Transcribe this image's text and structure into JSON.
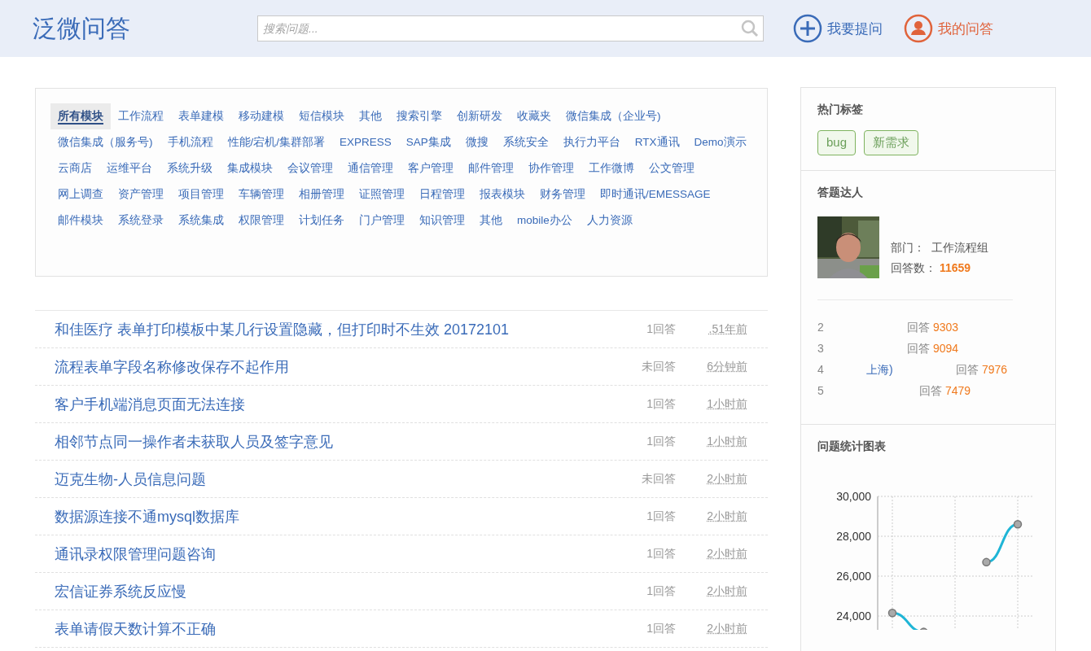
{
  "header": {
    "logo": "泛微问答",
    "search": {
      "placeholder": "搜索问题..."
    },
    "actions": [
      {
        "kind": "ask",
        "label": "我要提问"
      },
      {
        "kind": "mine",
        "label": "我的问答"
      }
    ]
  },
  "modules": [
    {
      "label": "所有模块",
      "selected": true
    },
    {
      "label": "工作流程",
      "selected": false
    },
    {
      "label": "表单建模",
      "selected": false
    },
    {
      "label": "移动建模",
      "selected": false
    },
    {
      "label": "短信模块",
      "selected": false
    },
    {
      "label": "其他",
      "selected": false
    },
    {
      "label": "搜索引擎",
      "selected": false
    },
    {
      "label": "创新研发",
      "selected": false
    },
    {
      "label": "收藏夹",
      "selected": false
    },
    {
      "label": "微信集成（企业号)",
      "selected": false
    },
    {
      "label": "微信集成（服务号)",
      "selected": false
    },
    {
      "label": "手机流程",
      "selected": false
    },
    {
      "label": "性能/宕机/集群部署",
      "selected": false
    },
    {
      "label": "EXPRESS",
      "selected": false
    },
    {
      "label": "SAP集成",
      "selected": false
    },
    {
      "label": "微搜",
      "selected": false
    },
    {
      "label": "系统安全",
      "selected": false
    },
    {
      "label": "执行力平台",
      "selected": false
    },
    {
      "label": "RTX通讯",
      "selected": false
    },
    {
      "label": "Demo演示",
      "selected": false
    },
    {
      "label": "云商店",
      "selected": false
    },
    {
      "label": "运维平台",
      "selected": false
    },
    {
      "label": "系统升级",
      "selected": false
    },
    {
      "label": "集成模块",
      "selected": false
    },
    {
      "label": "会议管理",
      "selected": false
    },
    {
      "label": "通信管理",
      "selected": false
    },
    {
      "label": "客户管理",
      "selected": false
    },
    {
      "label": "邮件管理",
      "selected": false
    },
    {
      "label": "协作管理",
      "selected": false
    },
    {
      "label": "工作微博",
      "selected": false
    },
    {
      "label": "公文管理",
      "selected": false
    },
    {
      "label": "网上调查",
      "selected": false
    },
    {
      "label": "资产管理",
      "selected": false
    },
    {
      "label": "项目管理",
      "selected": false
    },
    {
      "label": "车辆管理",
      "selected": false
    },
    {
      "label": "相册管理",
      "selected": false
    },
    {
      "label": "证照管理",
      "selected": false
    },
    {
      "label": "日程管理",
      "selected": false
    },
    {
      "label": "报表模块",
      "selected": false
    },
    {
      "label": "财务管理",
      "selected": false
    },
    {
      "label": "即时通讯/EMESSAGE",
      "selected": false
    },
    {
      "label": "邮件模块",
      "selected": false
    },
    {
      "label": "系统登录",
      "selected": false
    },
    {
      "label": "系统集成",
      "selected": false
    },
    {
      "label": "权限管理",
      "selected": false
    },
    {
      "label": "计划任务",
      "selected": false
    },
    {
      "label": "门户管理",
      "selected": false
    },
    {
      "label": "知识管理",
      "selected": false
    },
    {
      "label": "其他",
      "selected": false
    },
    {
      "label": "mobile办公",
      "selected": false
    },
    {
      "label": "人力资源",
      "selected": false
    }
  ],
  "questions": [
    {
      "title": "和佳医疗 表单打印模板中某几行设置隐藏，但打印时不生效 20172101",
      "answers": "1回答",
      "time": ".51年前"
    },
    {
      "title": "流程表单字段名称修改保存不起作用",
      "answers": "未回答",
      "time": "6分钟前"
    },
    {
      "title": "客户手机端消息页面无法连接",
      "answers": "1回答",
      "time": "1小时前"
    },
    {
      "title": "相邻节点同一操作者未获取人员及签字意见",
      "answers": "1回答",
      "time": "1小时前"
    },
    {
      "title": "迈克生物-人员信息问题",
      "answers": "未回答",
      "time": "2小时前"
    },
    {
      "title": "数据源连接不通mysql数据库",
      "answers": "1回答",
      "time": "2小时前"
    },
    {
      "title": "通讯录权限管理问题咨询",
      "answers": "1回答",
      "time": "2小时前"
    },
    {
      "title": "宏信证券系统反应慢",
      "answers": "1回答",
      "time": "2小时前"
    },
    {
      "title": "表单请假天数计算不正确",
      "answers": "1回答",
      "time": "2小时前"
    }
  ],
  "sidebar": {
    "hot_tags": {
      "title": "热门标签",
      "tags": [
        "bug",
        "新需求"
      ]
    },
    "experts": {
      "title": "答题达人",
      "top": {
        "dept_label": "部门：",
        "dept": "工作流程组",
        "count_label": "回答数：",
        "count": "11659"
      },
      "others": [
        {
          "rank": "2",
          "label": "回答",
          "count": "9303"
        },
        {
          "rank": "3",
          "label": "回答",
          "count": "9094"
        },
        {
          "rank": "4",
          "name_tail": "上海)",
          "label": "回答",
          "count": "7976"
        },
        {
          "rank": "5",
          "label": "回答",
          "count": "7479"
        }
      ]
    },
    "stats": {
      "title": "问题统计图表",
      "chart_data": {
        "type": "line",
        "ylim": [
          22000,
          30000
        ],
        "yticks": [
          {
            "value": 24000,
            "label": "24,000"
          },
          {
            "value": 26000,
            "label": "26,000"
          },
          {
            "value": 28000,
            "label": "28,000"
          },
          {
            "value": 30000,
            "label": "30,000"
          }
        ],
        "grid": true,
        "series": [
          {
            "color": "#1fb5d6",
            "marker": true,
            "values": [
              24150,
              23200,
              null,
              26700,
              28600
            ]
          }
        ]
      }
    }
  }
}
